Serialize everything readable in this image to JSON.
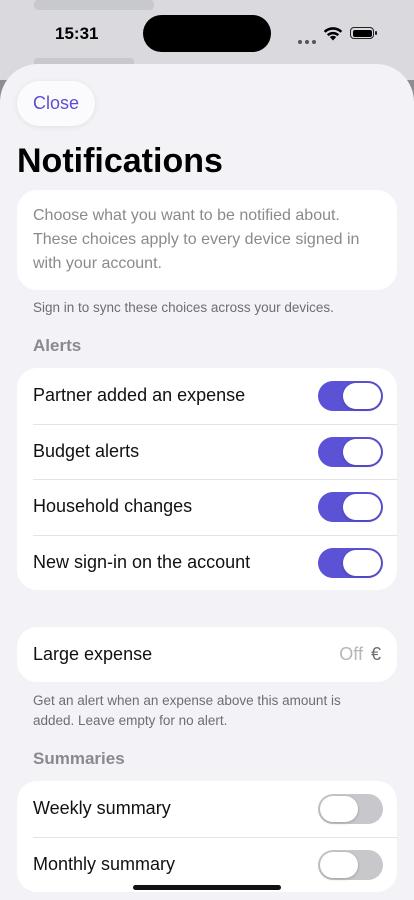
{
  "status_bar": {
    "time": "15:31"
  },
  "sheet": {
    "close_label": "Close",
    "title": "Notifications",
    "intro_text": "Choose what you want to be notified about. These choices apply to every device signed in with your account.",
    "sync_note": "Sign in to sync these choices across your devices.",
    "alerts": {
      "header": "Alerts",
      "items": [
        {
          "label": "Partner added an expense",
          "enabled": true
        },
        {
          "label": "Budget alerts",
          "enabled": true
        },
        {
          "label": "Household changes",
          "enabled": true
        },
        {
          "label": "New sign-in on the account",
          "enabled": true
        }
      ]
    },
    "large_expense": {
      "label": "Large expense",
      "value": "Off",
      "currency": "€",
      "note": "Get an alert when an expense above this amount is added. Leave empty for no alert."
    },
    "summaries": {
      "header": "Summaries",
      "items": [
        {
          "label": "Weekly summary",
          "enabled": false
        },
        {
          "label": "Monthly summary",
          "enabled": false
        }
      ]
    }
  },
  "colors": {
    "accent": "#5b52d6",
    "toggle_off": "#c7c7cc",
    "sheet_bg": "#f2f2f7"
  }
}
